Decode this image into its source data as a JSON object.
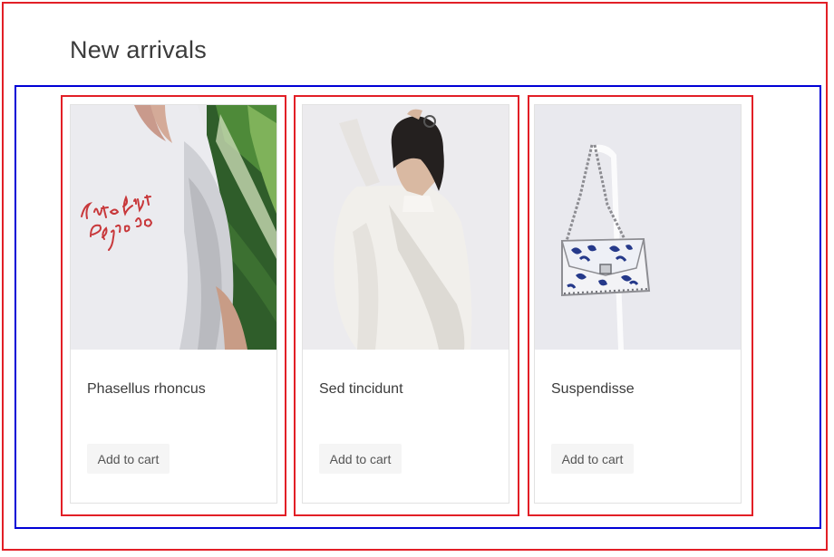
{
  "section": {
    "title": "New arrivals"
  },
  "products": [
    {
      "name": "Phasellus rhoncus",
      "button_label": "Add to cart",
      "image_text": "Cute but Psycho"
    },
    {
      "name": "Sed tincidunt",
      "button_label": "Add to cart"
    },
    {
      "name": "Suspendisse",
      "button_label": "Add to cart"
    }
  ],
  "colors": {
    "outer_frame": "#e21f26",
    "grid_frame": "#0000d6",
    "product_outline": "#e21f26",
    "button_bg": "#f5f5f5",
    "title_text": "#3b3b3b"
  }
}
